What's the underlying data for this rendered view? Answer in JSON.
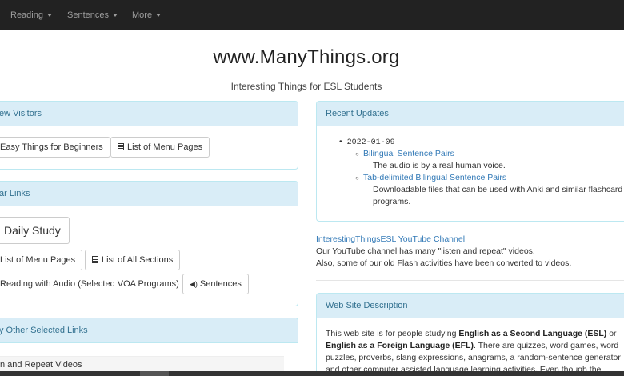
{
  "nav": {
    "items": [
      {
        "label": "Reading"
      },
      {
        "label": "Sentences"
      },
      {
        "label": "More"
      }
    ]
  },
  "header": {
    "title": "www.ManyThings.org",
    "subtitle": "Interesting Things for ESL Students"
  },
  "left": {
    "new_visitors": {
      "heading": "ew Visitors",
      "buttons": [
        "Easy Things for Beginners",
        "List of Menu Pages"
      ]
    },
    "popular": {
      "heading": "ar Links",
      "daily": "Daily Study",
      "menu_pages": "List of Menu Pages",
      "all_sections": "List of All Sections",
      "reading_audio": "Reading with Audio (Selected VOA Programs)",
      "sentences": "Sentences"
    },
    "other": {
      "heading": "y Other Selected Links",
      "first_item": "n and Repeat Videos"
    }
  },
  "right": {
    "updates": {
      "heading": "Recent Updates",
      "date": "2022-01-09",
      "item1_link": "Bilingual Sentence Pairs",
      "item1_text": "The audio is by a real human voice.",
      "item2_link": "Tab-delimited Bilingual Sentence Pairs",
      "item2_text_1": "Downloadable files that can be used with Anki and similar flashcard",
      "item2_text_2": "programs."
    },
    "youtube": {
      "link": "InterestingThingsESL YouTube Channel",
      "line1": "Our YouTube channel has many \"listen and repeat\" videos.",
      "line2": "Also, some of our old Flash activities have been converted to videos."
    },
    "description": {
      "heading": "Web Site Description",
      "p1": "This web site is for people studying ",
      "b1": "English as a Second Language (ESL)",
      "p2": " or ",
      "b2": "English as a Foreign Language (EFL)",
      "p3": ". There are quizzes, word games, word puzzles, proverbs, slang expressions, anagrams, a random-sentence generator and other computer assisted language learning activities. Even though the primary foc"
    }
  }
}
